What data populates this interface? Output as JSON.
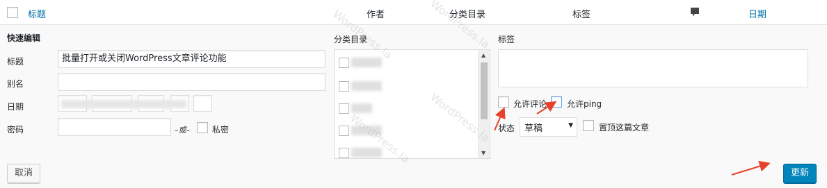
{
  "header": {
    "title_col": "标题",
    "author_col": "作者",
    "category_col": "分类目录",
    "tags_col": "标签",
    "date_col": "日期"
  },
  "quick_edit": {
    "section_title": "快速编辑",
    "title_label": "标题",
    "title_value": "批量打开或关闭WordPress文章评论功能",
    "slug_label": "别名",
    "slug_value": "",
    "date_label": "日期",
    "password_label": "密码",
    "password_value": "",
    "or_text": "–或–",
    "private_label": "私密",
    "category_label": "分类目录",
    "tags_label": "标签",
    "allow_comments_label": "允许评论",
    "allow_ping_label": "允许ping",
    "status_label": "状态",
    "status_value": "草稿",
    "sticky_label": "置顶这篇文章",
    "cancel_label": "取消",
    "update_label": "更新"
  },
  "watermark_text": "WordPress.la",
  "colors": {
    "link": "#0073aa",
    "primary_button": "#0085ba",
    "annotation_arrow": "#e8412b"
  }
}
